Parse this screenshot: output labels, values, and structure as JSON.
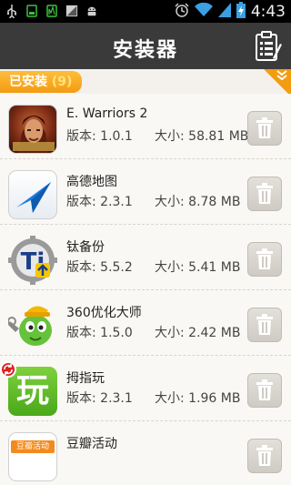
{
  "status_bar": {
    "time": "4:43",
    "icons": [
      "usb-icon",
      "battery-app-icon",
      "signal-app-icon",
      "image-icon",
      "android-icon",
      "alarm-icon",
      "wifi-icon",
      "cell-signal-icon",
      "battery-charging-icon"
    ]
  },
  "header": {
    "title": "安装器",
    "action_icon": "clipboard-list-icon"
  },
  "section": {
    "label": "已安装",
    "count": "(9)"
  },
  "apps": [
    {
      "name": "E. Warriors 2",
      "version": "版本: 1.0.1",
      "size": "大小: 58.81 MB",
      "icon": "warriors-app-icon"
    },
    {
      "name": "高德地图",
      "version": "版本: 2.3.1",
      "size": "大小: 8.78 MB",
      "icon": "amap-app-icon"
    },
    {
      "name": "钛备份",
      "version": "版本: 5.5.2",
      "size": "大小: 5.41 MB",
      "icon": "titanium-backup-app-icon"
    },
    {
      "name": "360优化大师",
      "version": "版本: 1.5.0",
      "size": "大小: 2.42 MB",
      "icon": "360-optimizer-app-icon"
    },
    {
      "name": "拇指玩",
      "version": "版本: 2.3.1",
      "size": "大小: 1.96 MB",
      "icon": "muzhiwan-app-icon",
      "icon_text": "玩",
      "badge": true
    },
    {
      "name": "豆瓣活动",
      "version": "",
      "size": "",
      "icon": "douban-events-app-icon",
      "icon_text": "豆瓣活动"
    }
  ],
  "colors": {
    "accent": "#f39c12",
    "titlebar": "#3a3a3a",
    "background": "#f4f1ec"
  }
}
